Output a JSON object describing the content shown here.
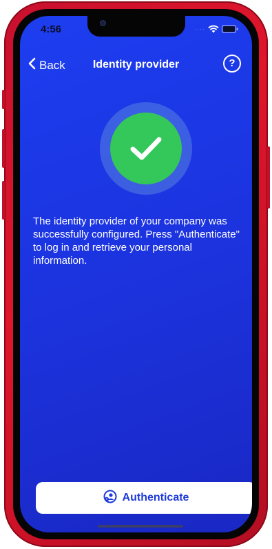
{
  "status_bar": {
    "time": "4:56"
  },
  "nav": {
    "back_label": "Back",
    "title": "Identity provider",
    "help_symbol": "?"
  },
  "success_badge": {
    "icon": "checkmark-icon",
    "color": "#34c759"
  },
  "message": "The identity provider of your company was successfully configured. Press \"Authenticate\" to log in and retrieve your personal information.",
  "actions": {
    "authenticate_label": "Authenticate",
    "authenticate_icon": "user-key-icon"
  },
  "colors": {
    "background": "#1d3ef0",
    "device_frame": "#c8102e",
    "button_text": "#1e3ad8"
  }
}
